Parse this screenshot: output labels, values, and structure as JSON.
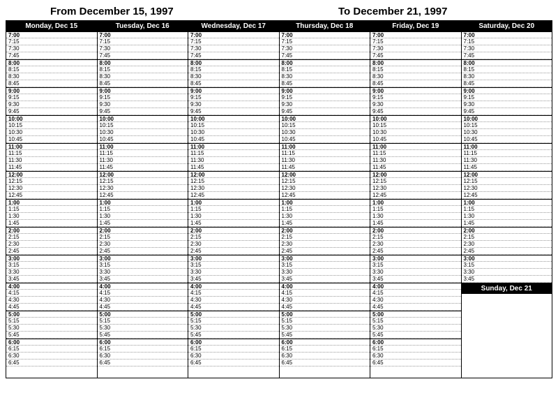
{
  "title_from": "From December 15, 1997",
  "title_to": "To December 21, 1997",
  "days": [
    {
      "label": "Monday, Dec 15",
      "hours_start": 7,
      "hours_end": 18
    },
    {
      "label": "Tuesday, Dec 16",
      "hours_start": 7,
      "hours_end": 18
    },
    {
      "label": "Wednesday, Dec 17",
      "hours_start": 7,
      "hours_end": 18
    },
    {
      "label": "Thursday, Dec 18",
      "hours_start": 7,
      "hours_end": 18
    },
    {
      "label": "Friday, Dec 19",
      "hours_start": 7,
      "hours_end": 18
    },
    {
      "label": "Saturday, Dec 20",
      "hours_start": 7,
      "hours_end": 15
    }
  ],
  "sunday_label": "Sunday, Dec 21",
  "minute_marks": [
    "00",
    "15",
    "30",
    "45"
  ],
  "chart_data": {
    "type": "table",
    "title": "Weekly planner, Dec 15–21 1997, 15-minute time slots",
    "days": [
      "Monday, Dec 15",
      "Tuesday, Dec 16",
      "Wednesday, Dec 17",
      "Thursday, Dec 18",
      "Friday, Dec 19",
      "Saturday, Dec 20",
      "Sunday, Dec 21"
    ],
    "time_range": {
      "start": "7:00",
      "end": "6:45",
      "interval_minutes": 15
    },
    "notes": "Saturday column ends at 3:45; Sunday occupies the remaining space below Saturday with no time slots shown."
  }
}
